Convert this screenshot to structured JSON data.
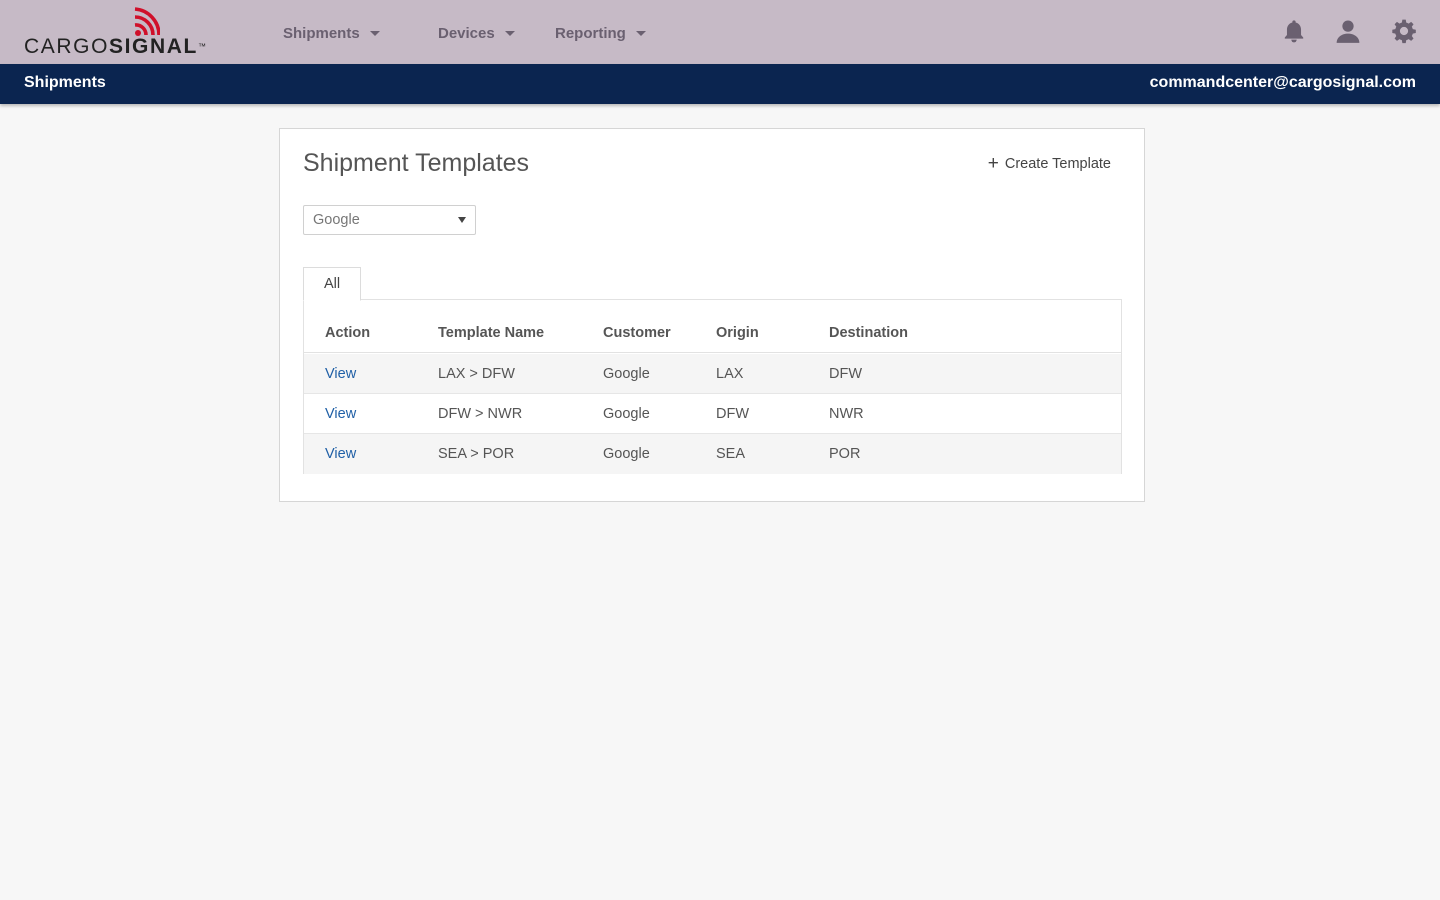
{
  "brand": {
    "logo_text_light": "CARGO",
    "logo_text_bold": "SIGNAL",
    "logo_tm": "™",
    "wave_color": "#d0102a"
  },
  "topnav": {
    "items": [
      {
        "label": "Shipments"
      },
      {
        "label": "Devices"
      },
      {
        "label": "Reporting"
      }
    ],
    "icons": [
      "bell-icon",
      "user-icon",
      "gear-icon"
    ],
    "background": "#c6bac6"
  },
  "subbar": {
    "title": "Shipments",
    "user_email": "commandcenter@cargosignal.com",
    "background": "#0b2550"
  },
  "card": {
    "title": "Shipment Templates",
    "create_label": "Create Template",
    "customer_select": {
      "value": "Google"
    },
    "tabs": [
      {
        "label": "All"
      }
    ],
    "table": {
      "columns": [
        "Action",
        "Template Name",
        "Customer",
        "Origin",
        "Destination"
      ],
      "rows": [
        {
          "action": "View",
          "template_name": "LAX > DFW",
          "customer": "Google",
          "origin": "LAX",
          "destination": "DFW"
        },
        {
          "action": "View",
          "template_name": "DFW > NWR",
          "customer": "Google",
          "origin": "DFW",
          "destination": "NWR"
        },
        {
          "action": "View",
          "template_name": "SEA > POR",
          "customer": "Google",
          "origin": "SEA",
          "destination": "POR"
        }
      ]
    }
  },
  "colors": {
    "link": "#1f5fa6"
  }
}
